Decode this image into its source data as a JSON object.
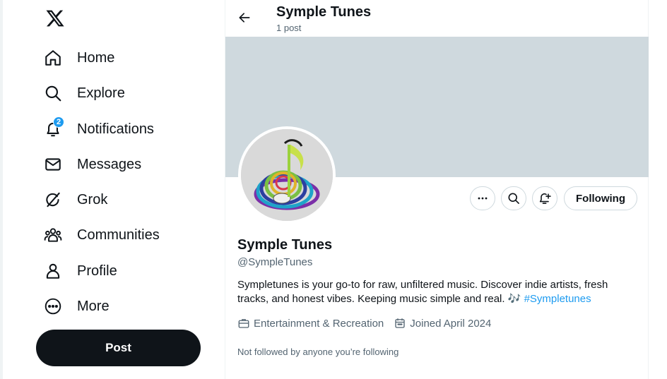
{
  "sidebar": {
    "logo_icon": "x-logo-icon",
    "items": [
      {
        "label": "Home",
        "icon": "home-icon"
      },
      {
        "label": "Explore",
        "icon": "search-icon"
      },
      {
        "label": "Notifications",
        "icon": "bell-icon",
        "badge": "2"
      },
      {
        "label": "Messages",
        "icon": "envelope-icon"
      },
      {
        "label": "Grok",
        "icon": "grok-icon"
      },
      {
        "label": "Communities",
        "icon": "people-icon"
      },
      {
        "label": "Profile",
        "icon": "person-icon"
      },
      {
        "label": "More",
        "icon": "more-circle-icon"
      }
    ],
    "post_label": "Post"
  },
  "header": {
    "title": "Symple Tunes",
    "subtitle": "1 post"
  },
  "profile": {
    "name": "Symple Tunes",
    "handle": "@SympleTunes",
    "bio_text": "Sympletunes is your go-to for raw, unfiltered music. Discover indie artists, fresh tracks, and honest vibes. Keeping music simple and real. ",
    "bio_emoji": "🎶",
    "bio_hashtag": "#Sympletunes",
    "category": "Entertainment & Recreation",
    "joined": "Joined April 2024",
    "followers_note": "Not followed by anyone you’re following",
    "following_label": "Following"
  },
  "colors": {
    "accent": "#1d9bf0",
    "banner": "#cfd9de",
    "text_primary": "#0f1419",
    "text_secondary": "#536471"
  }
}
